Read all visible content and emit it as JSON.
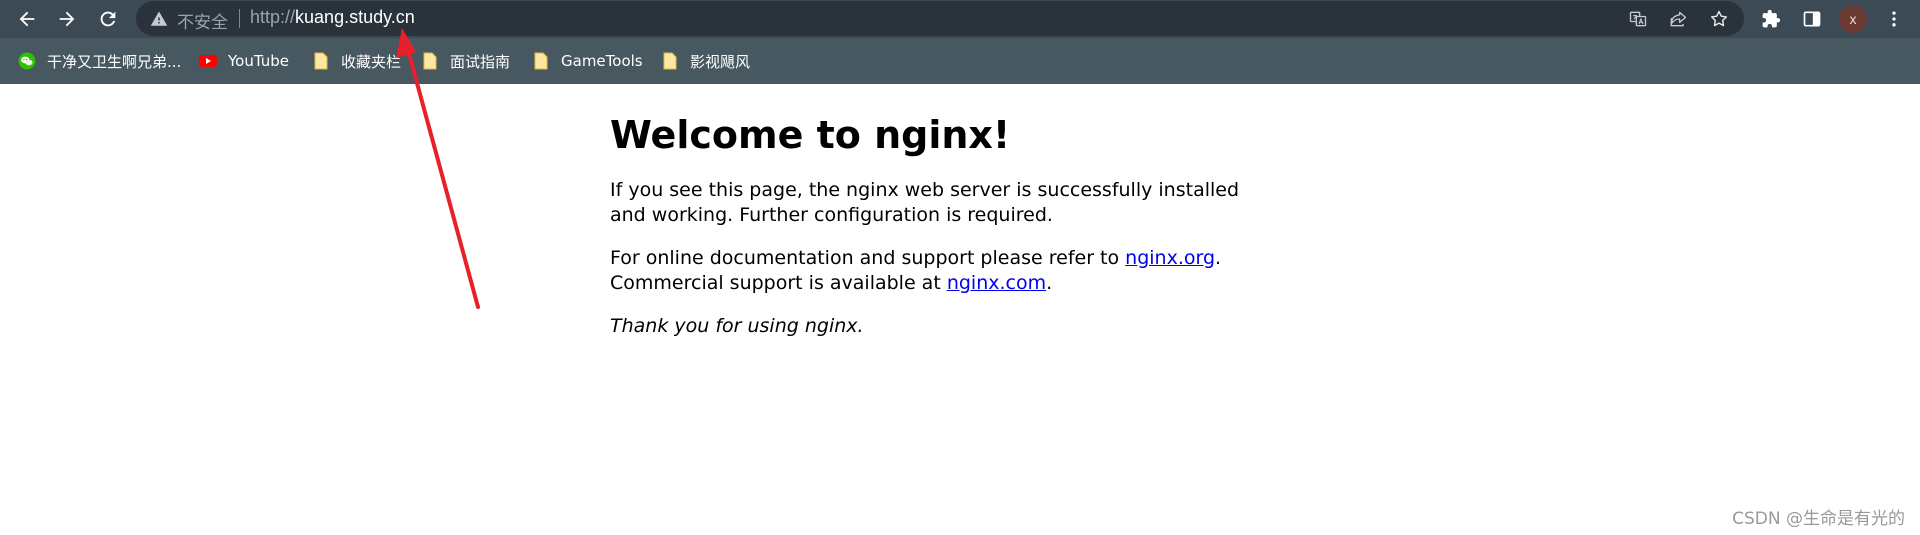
{
  "browser": {
    "security_label": "不安全",
    "url": {
      "scheme": "http://",
      "host": "kuang.study.cn"
    },
    "profile_initial": "x",
    "icons": {
      "back": "arrow-left-icon",
      "forward": "arrow-right-icon",
      "reload": "reload-icon",
      "security": "warning-triangle-icon",
      "translate": "translate-icon",
      "share": "share-icon",
      "bookmark": "star-icon",
      "extensions": "puzzle-icon",
      "side_panel": "side-panel-icon",
      "menu": "kebab-menu-icon"
    },
    "colors": {
      "toolbar": "#3c4a55",
      "omnibox": "#2a333b",
      "bookmarks_bar": "#475861"
    }
  },
  "bookmarks": [
    {
      "label": "干净又卫生啊兄弟...",
      "icon": "wechat-icon"
    },
    {
      "label": "YouTube",
      "icon": "youtube-icon"
    },
    {
      "label": "收藏夹栏",
      "icon": "folder-icon"
    },
    {
      "label": "面试指南",
      "icon": "folder-icon"
    },
    {
      "label": "GameTools",
      "icon": "folder-icon"
    },
    {
      "label": "影视飓风",
      "icon": "folder-icon"
    }
  ],
  "page": {
    "heading": "Welcome to nginx!",
    "para1": "If you see this page, the nginx web server is successfully installed and working. Further configuration is required.",
    "para2_pre": "For online documentation and support please refer to ",
    "link_org": "nginx.org",
    "para2_mid": ".",
    "para2_line2": "Commercial support is available at ",
    "link_com": "nginx.com",
    "para2_end": ".",
    "thanks": "Thank you for using nginx."
  },
  "watermark": "CSDN @生命是有光的",
  "annotation": {
    "arrow_color": "#e8202a"
  }
}
